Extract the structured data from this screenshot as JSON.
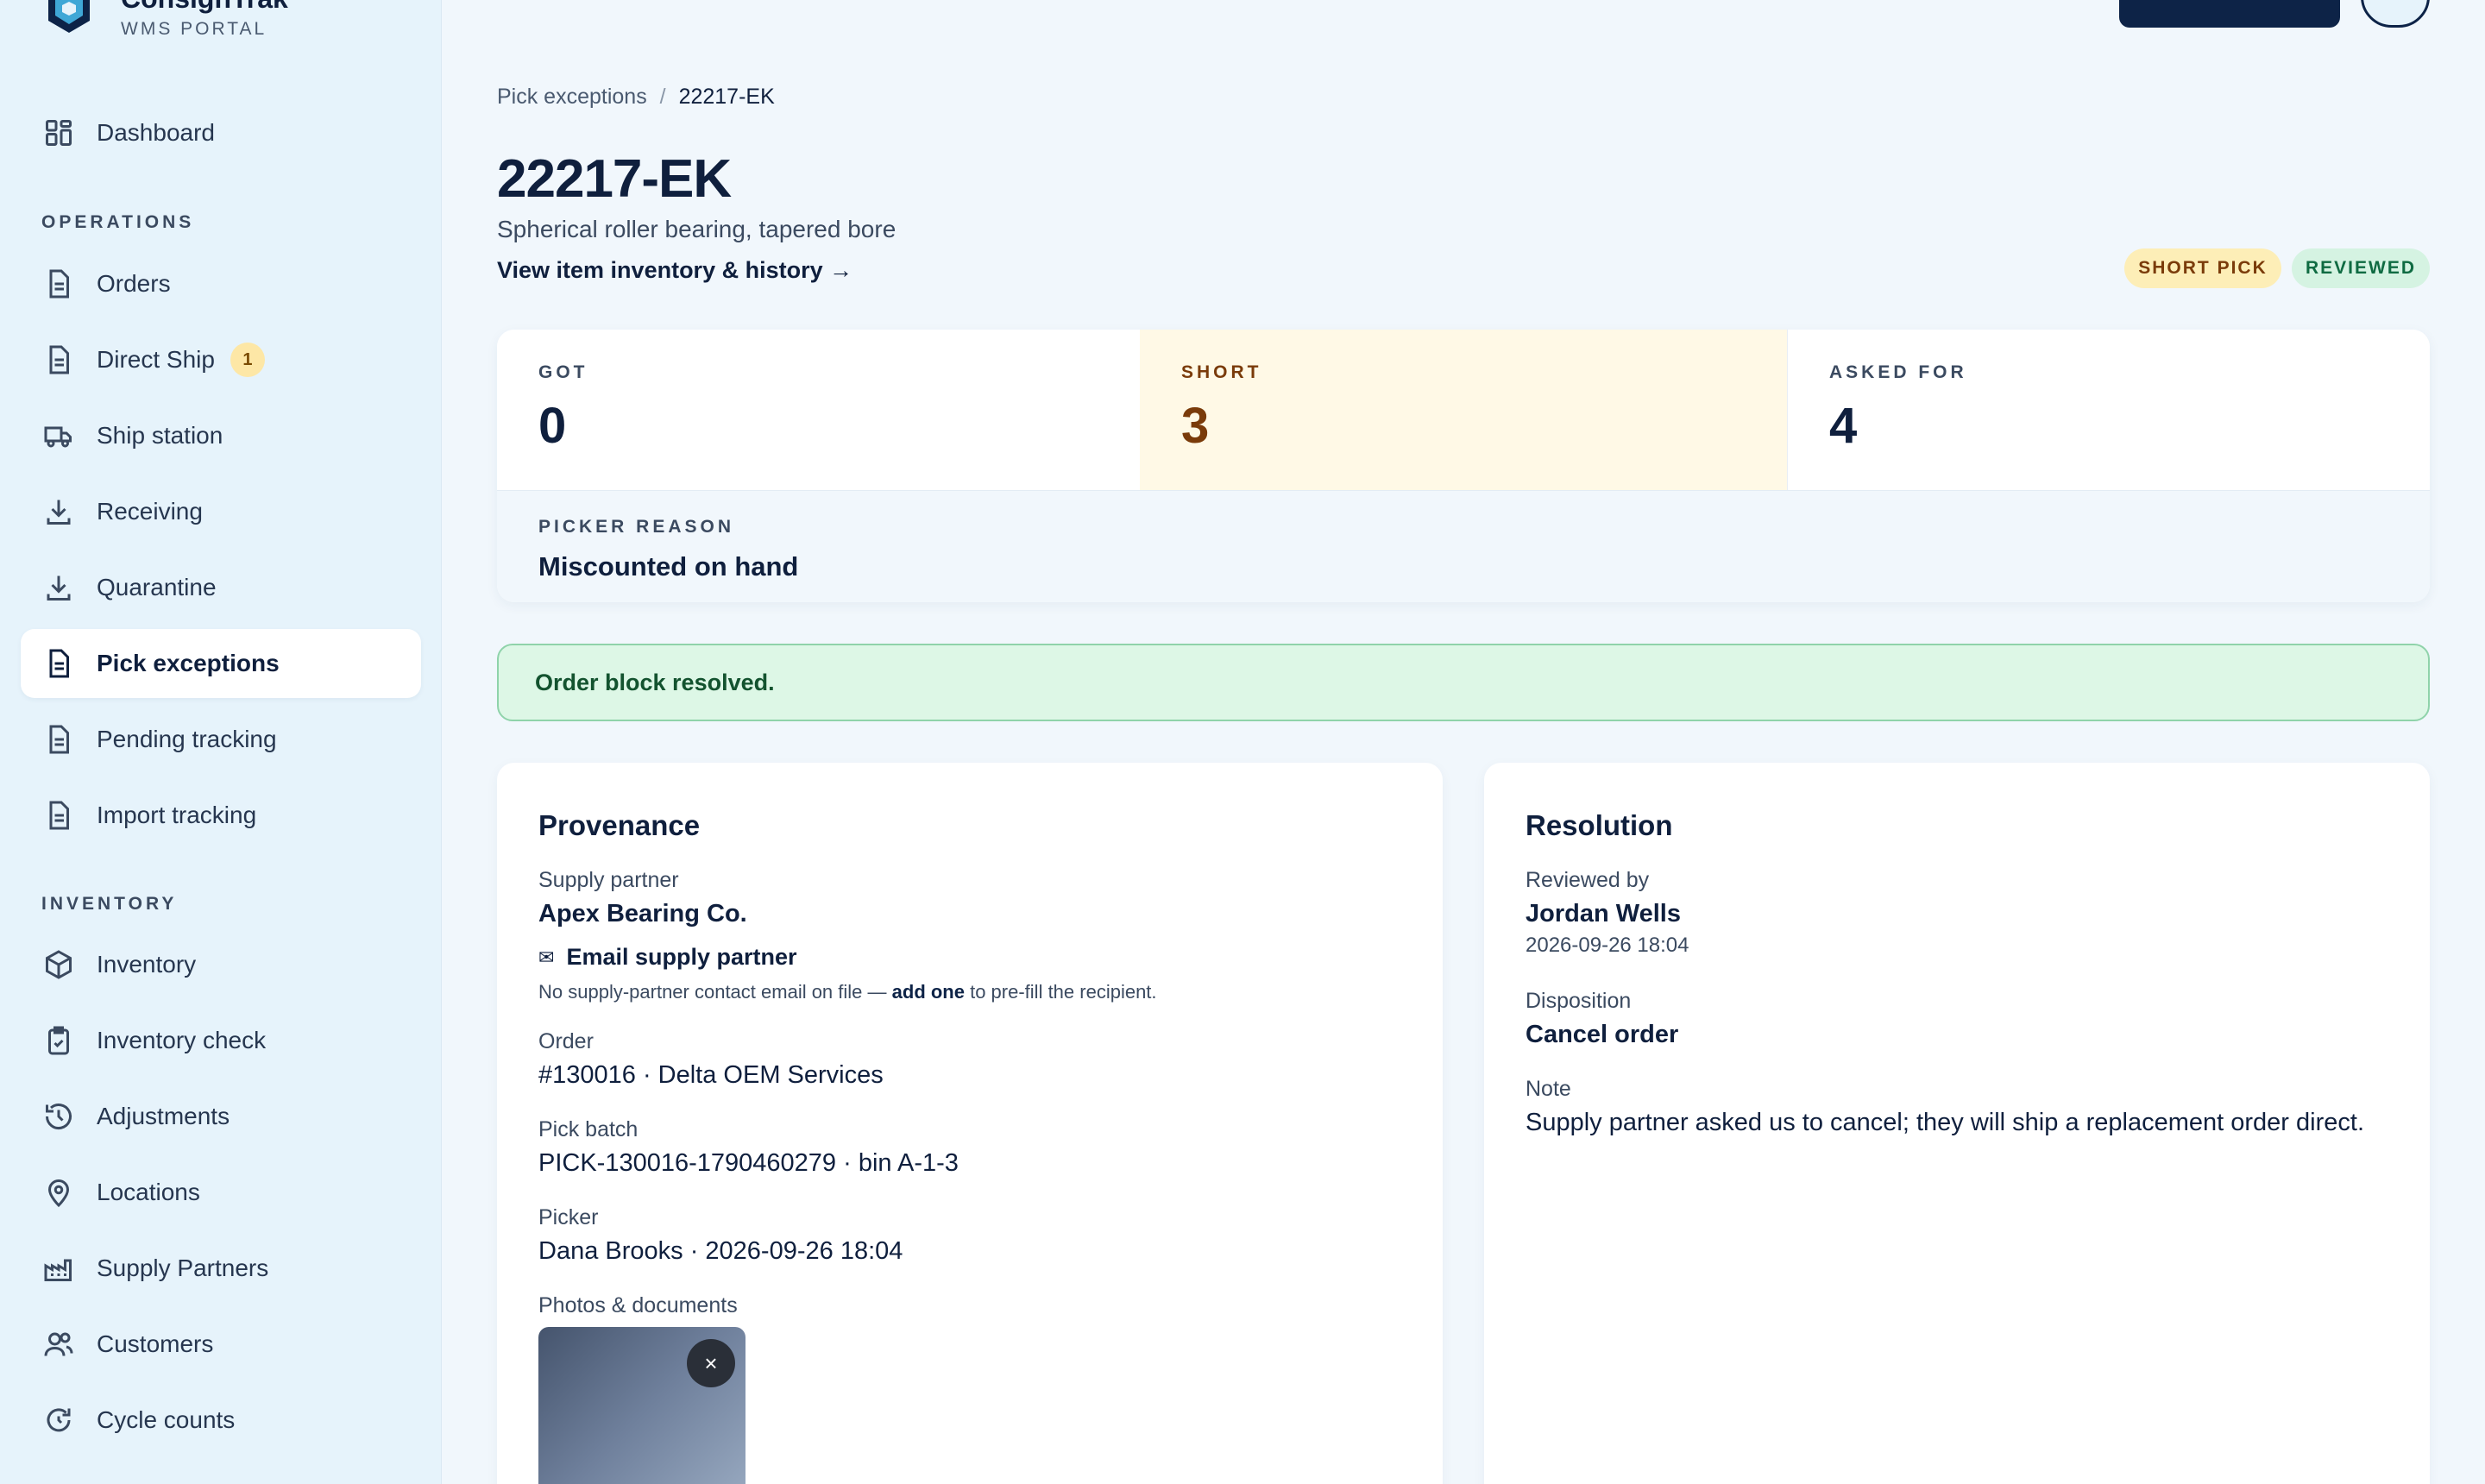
{
  "brand": {
    "name": "ConsignTrak",
    "subtitle": "WMS PORTAL"
  },
  "sidebar": {
    "dashboard": "Dashboard",
    "sections": {
      "operations": "OPERATIONS",
      "inventory": "INVENTORY"
    },
    "operations": [
      {
        "label": "Orders",
        "icon": "document-icon"
      },
      {
        "label": "Direct Ship",
        "icon": "document-icon",
        "badge": "1"
      },
      {
        "label": "Ship station",
        "icon": "truck-icon"
      },
      {
        "label": "Receiving",
        "icon": "download-icon"
      },
      {
        "label": "Quarantine",
        "icon": "download-icon"
      },
      {
        "label": "Pick exceptions",
        "icon": "document-icon",
        "active": true
      },
      {
        "label": "Pending tracking",
        "icon": "document-icon"
      },
      {
        "label": "Import tracking",
        "icon": "document-icon"
      }
    ],
    "inventory": [
      {
        "label": "Inventory",
        "icon": "box-icon"
      },
      {
        "label": "Inventory check",
        "icon": "clipboard-check-icon"
      },
      {
        "label": "Adjustments",
        "icon": "history-icon"
      },
      {
        "label": "Locations",
        "icon": "map-pin-icon"
      },
      {
        "label": "Supply Partners",
        "icon": "factory-icon"
      },
      {
        "label": "Customers",
        "icon": "users-icon"
      },
      {
        "label": "Cycle counts",
        "icon": "refresh-icon"
      }
    ]
  },
  "breadcrumb": {
    "parent": "Pick exceptions",
    "separator": "/",
    "current": "22217-EK"
  },
  "item": {
    "title": "22217-EK",
    "description": "Spherical roller bearing, tapered bore",
    "link": "View item inventory & history →"
  },
  "status": {
    "pill1": "SHORT PICK",
    "pill2": "REVIEWED"
  },
  "stats": {
    "got": {
      "label": "GOT",
      "value": "0"
    },
    "short": {
      "label": "SHORT",
      "value": "3"
    },
    "asked": {
      "label": "ASKED FOR",
      "value": "4"
    },
    "reason_label": "PICKER REASON",
    "reason_value": "Miscounted on hand"
  },
  "alert": "Order block resolved.",
  "provenance": {
    "title": "Provenance",
    "supply_label": "Supply partner",
    "supply_value": "Apex Bearing Co.",
    "email_link": "Email supply partner",
    "email_note_pre": "No supply-partner contact email on file — ",
    "email_note_link": "add one",
    "email_note_post": " to pre-fill the recipient.",
    "order_label": "Order",
    "order_value": "#130016 · Delta OEM Services",
    "batch_label": "Pick batch",
    "batch_value": "PICK-130016-1790460279 · bin A-1-3",
    "picker_label": "Picker",
    "picker_value": "Dana Brooks · 2026-09-26 18:04",
    "photos_label": "Photos & documents",
    "photo_close": "×"
  },
  "resolution": {
    "title": "Resolution",
    "reviewed_label": "Reviewed by",
    "reviewed_value": "Jordan Wells",
    "reviewed_date": "2026-09-26 18:04",
    "disposition_label": "Disposition",
    "disposition_value": "Cancel order",
    "note_label": "Note",
    "note_value": "Supply partner asked us to cancel; they will ship a replacement order direct."
  },
  "colors": {
    "navy": "#0d2347",
    "sidebar_bg": "#e6f3fb",
    "short_bg": "#fff9e6",
    "short_text": "#7a3b0a",
    "success_bg": "#ddf7e6",
    "success_border": "#8fd3aa"
  }
}
